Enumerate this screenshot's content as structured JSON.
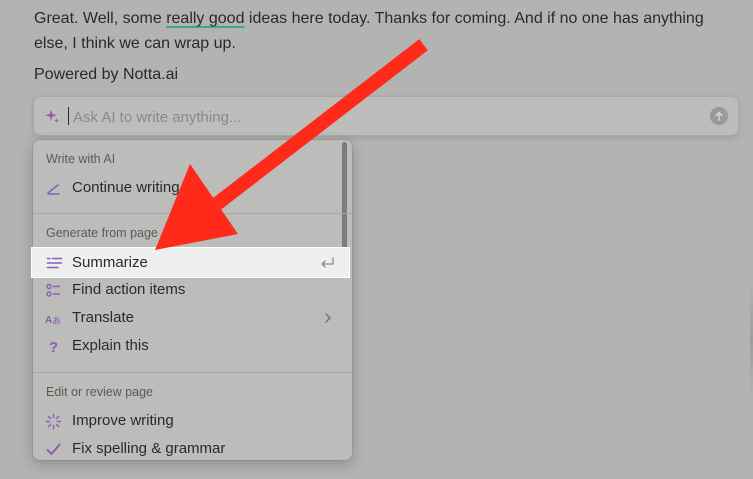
{
  "transcript": {
    "line1_before": "Great. Well, some ",
    "line1_highlight": "really good",
    "line1_after": " ideas here today. Thanks for coming. And if no one has anything",
    "line2": "else, I think we can wrap up."
  },
  "powered_by": "Powered by Notta.ai",
  "ai_bar": {
    "placeholder": "Ask AI to write anything...",
    "value": "",
    "icon": "sparkle-icon",
    "send_icon": "arrow-up-circle-icon"
  },
  "menu": {
    "sections": [
      {
        "heading": "Write with AI",
        "items": [
          {
            "label": "Continue writing",
            "icon": "pen-icon"
          }
        ]
      },
      {
        "heading": "Generate from page",
        "items": [
          {
            "label": "Summarize",
            "icon": "summary-lines-icon",
            "trailing_icon": "return-key-icon",
            "selected": true
          },
          {
            "label": "Find action items",
            "icon": "checklist-icon"
          },
          {
            "label": "Translate",
            "icon": "translate-icon",
            "trailing_icon": "chevron-right-icon"
          },
          {
            "label": "Explain this",
            "icon": "question-mark-icon"
          }
        ]
      },
      {
        "heading": "Edit or review page",
        "items": [
          {
            "label": "Improve writing",
            "icon": "sparkle-burst-icon"
          },
          {
            "label": "Fix spelling & grammar",
            "icon": "checkmark-icon"
          }
        ]
      }
    ]
  },
  "colors": {
    "accent_purple": "#8a5fb3",
    "annotation_arrow": "#ff2a1a",
    "underline": "#3aa593"
  }
}
